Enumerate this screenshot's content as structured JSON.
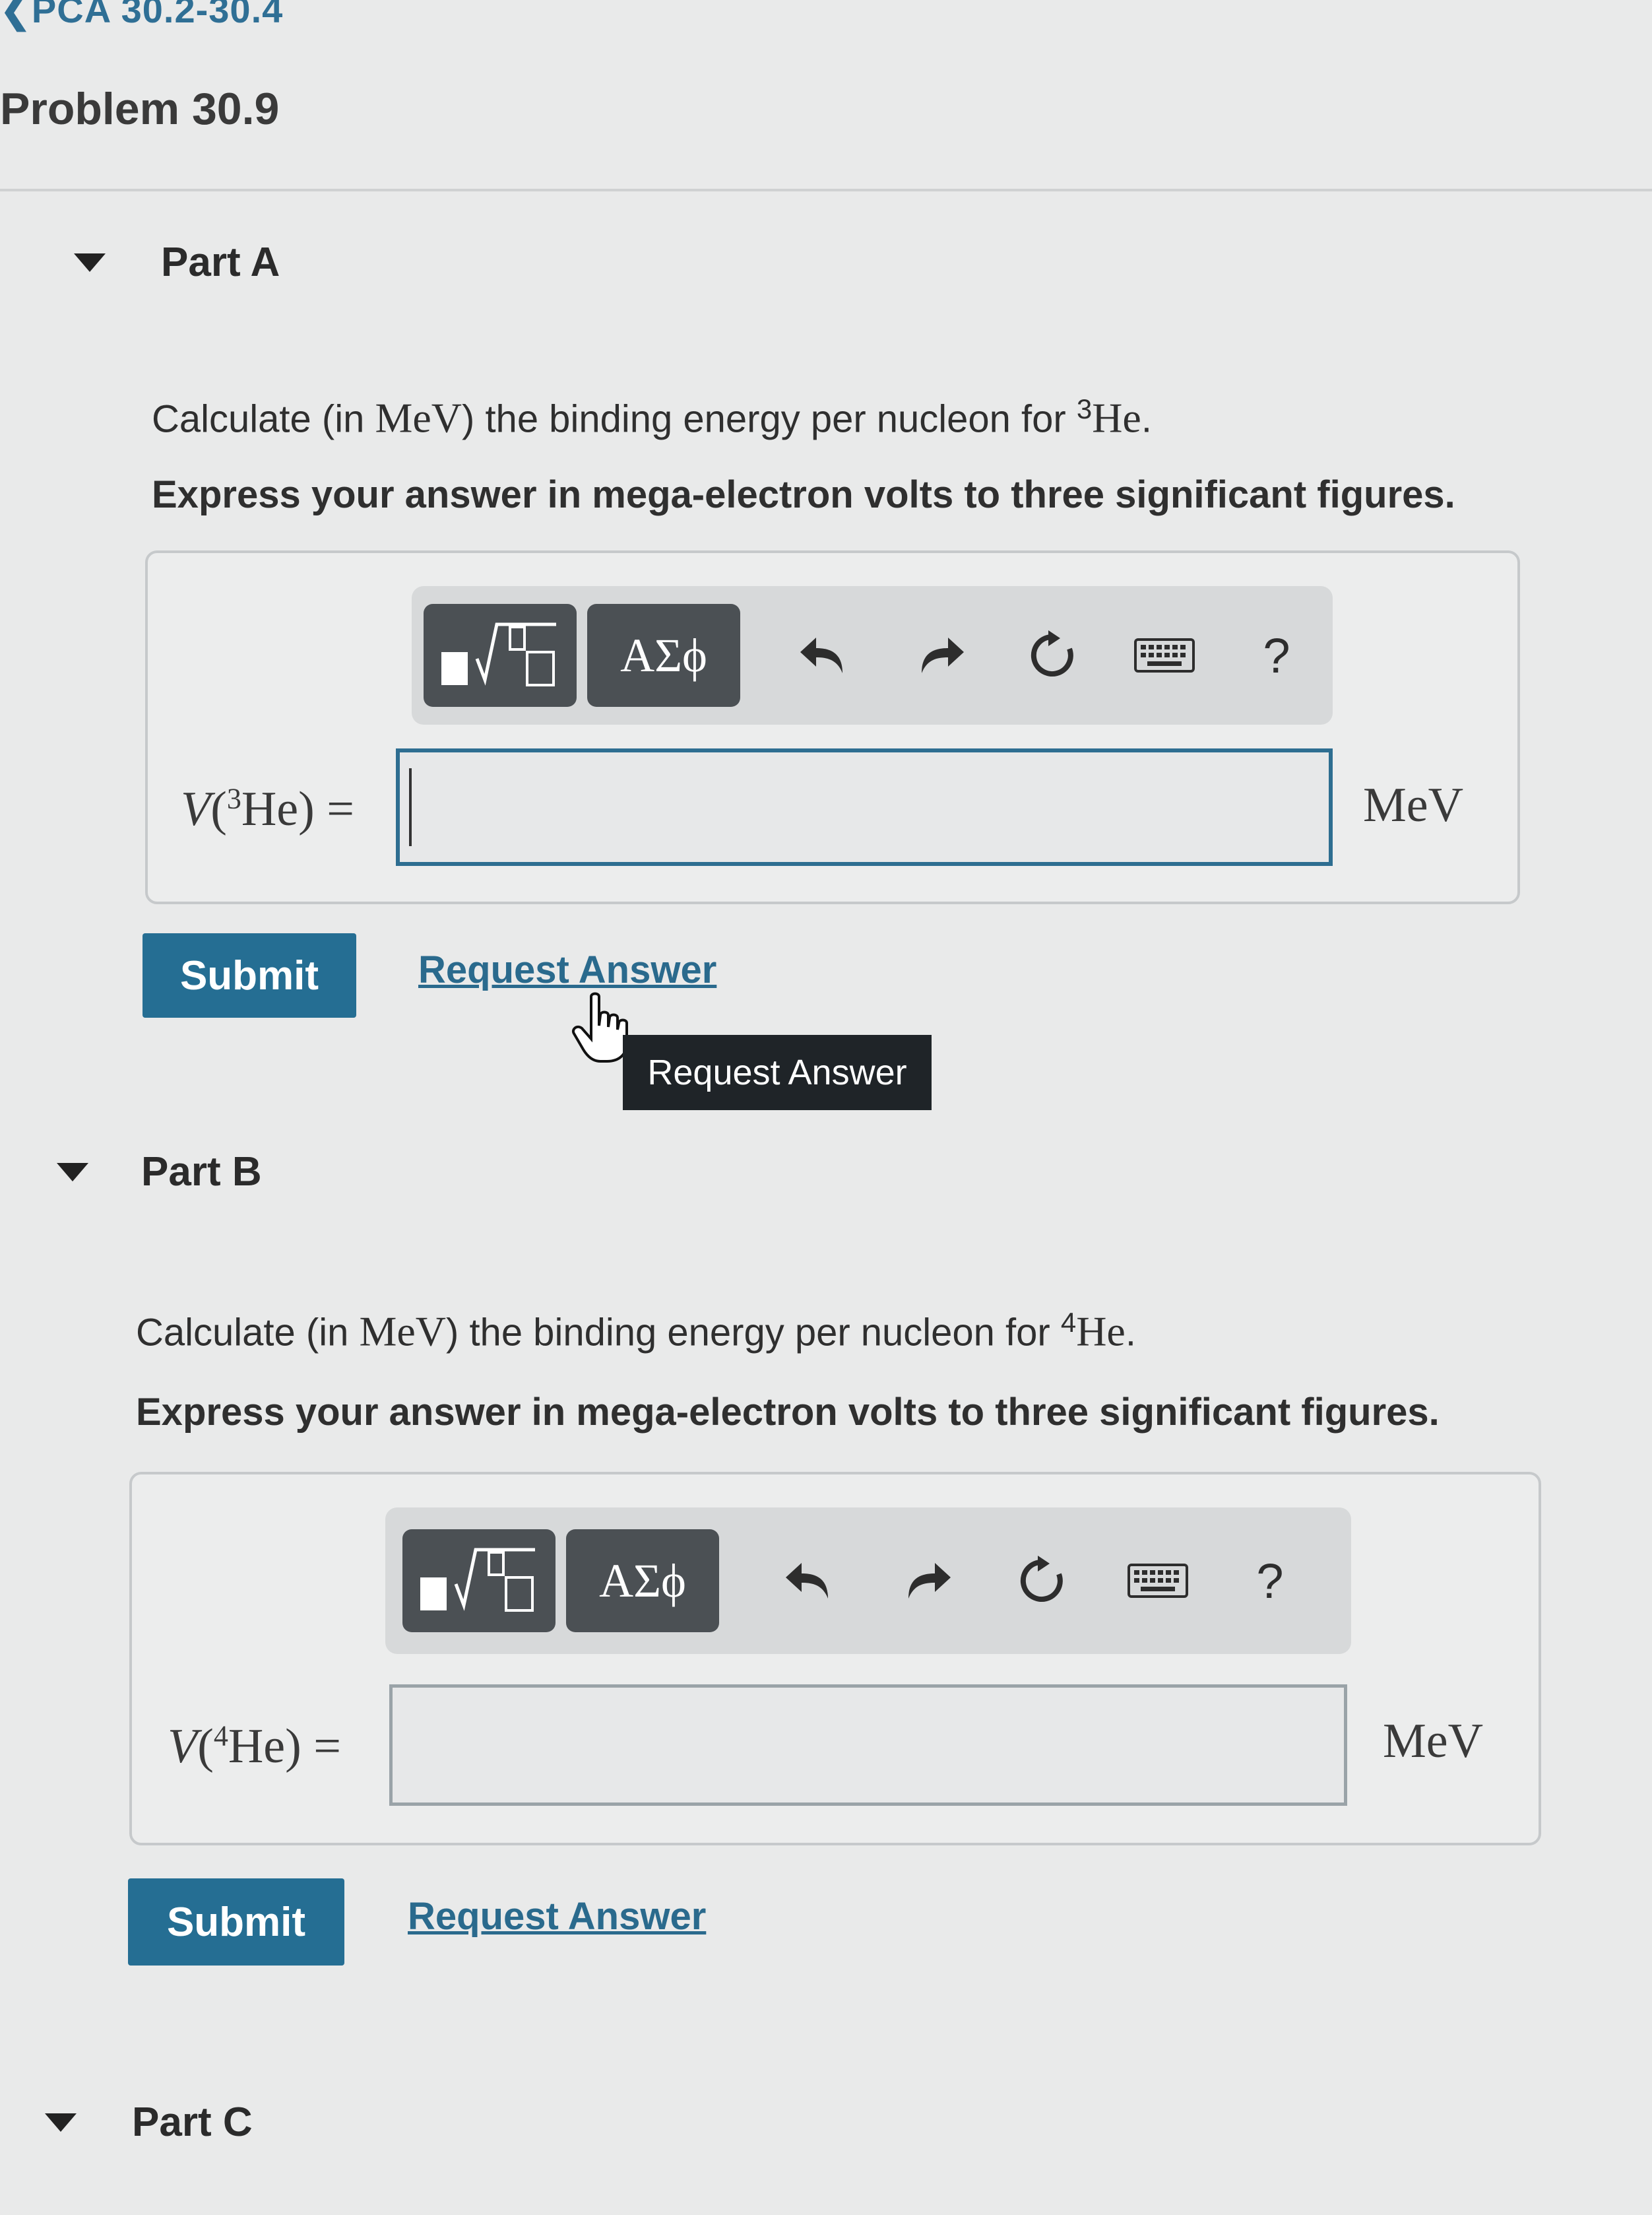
{
  "header": {
    "breadcrumb": "❮PCA 30.2-30.4",
    "problem_title": "Problem 30.9"
  },
  "toolbar": {
    "symbols_label": "ΑΣϕ",
    "help_label": "?"
  },
  "parts": [
    {
      "label": "Part A",
      "question_prefix": "Calculate (in ",
      "question_unit": "MeV",
      "question_middle": ") the binding energy per nucleon for ",
      "isotope_mass": "3",
      "isotope_symbol": "He",
      "question_end": ".",
      "instruction": "Express your answer in mega-electron volts to three significant figures.",
      "var_symbol": "V",
      "var_mass": "3",
      "var_element": "He",
      "var_suffix": ") =",
      "input_value": "",
      "unit": "MeV",
      "submit_label": "Submit",
      "request_label": "Request Answer",
      "tooltip": "Request Answer"
    },
    {
      "label": "Part B",
      "question_prefix": "Calculate (in ",
      "question_unit": "MeV",
      "question_middle": ") the binding energy per nucleon for ",
      "isotope_mass": "4",
      "isotope_symbol": "He",
      "question_end": ".",
      "instruction": "Express your answer in mega-electron volts to three significant figures.",
      "var_symbol": "V",
      "var_mass": "4",
      "var_element": "He",
      "var_suffix": ") =",
      "input_value": "",
      "unit": "MeV",
      "submit_label": "Submit",
      "request_label": "Request Answer"
    },
    {
      "label": "Part C"
    }
  ]
}
